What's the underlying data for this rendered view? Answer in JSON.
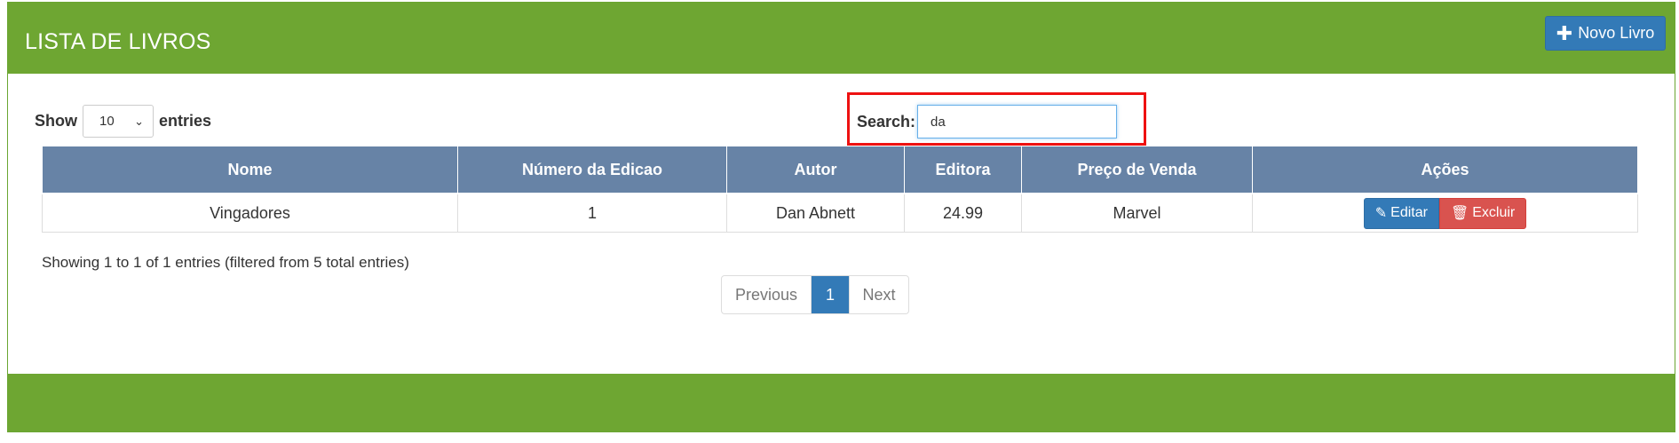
{
  "header": {
    "title": "LISTA DE LIVROS",
    "new_button_label": "Novo Livro",
    "new_button_icon": "plus-icon"
  },
  "length": {
    "show_label": "Show",
    "selected": "10",
    "entries_label": "entries"
  },
  "search": {
    "label": "Search:",
    "value": "da"
  },
  "table": {
    "columns": [
      "Nome",
      "Número da Edicao",
      "Autor",
      "Editora",
      "Preço de Venda",
      "Ações"
    ],
    "rows": [
      {
        "nome": "Vingadores",
        "edicao": "1",
        "autor": "Dan Abnett",
        "editora": "24.99",
        "preco": "Marvel"
      }
    ],
    "edit_label": "Editar",
    "delete_label": "Excluir"
  },
  "info": "Showing 1 to 1 of 1 entries (filtered from 5 total entries)",
  "pagination": {
    "previous": "Previous",
    "current": "1",
    "next": "Next"
  },
  "colors": {
    "header_green": "#6ea632",
    "table_header": "#6783a6",
    "primary": "#337ab7",
    "danger": "#d9534f",
    "highlight": "#ee1111"
  }
}
